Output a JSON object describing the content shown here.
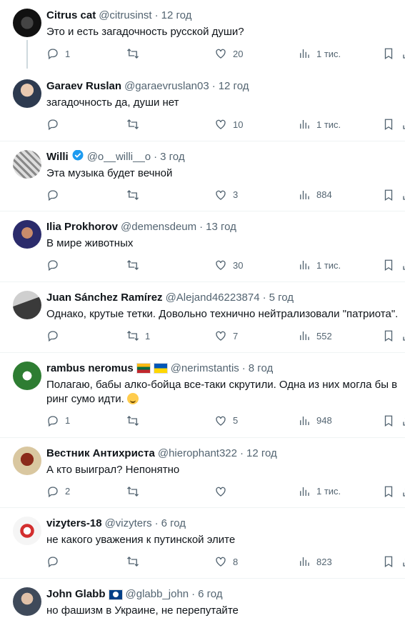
{
  "replies": [
    {
      "author": "Citrus cat",
      "handle": "@citrusinst",
      "time": "12 год",
      "text": "Это и есть загадочность русской души?",
      "replies": "1",
      "retweets": "",
      "likes": "20",
      "views": "1 тис."
    },
    {
      "author": "Garaev Ruslan",
      "handle": "@garaevruslan03",
      "time": "12 год",
      "text": "загадочность да, души нет",
      "replies": "",
      "retweets": "",
      "likes": "10",
      "views": "1 тис."
    },
    {
      "author": "Willi",
      "handle": "@o__willi__o",
      "time": "3 год",
      "text": "Эта музыка будет вечной",
      "replies": "",
      "retweets": "",
      "likes": "3",
      "views": "884"
    },
    {
      "author": "Ilia Prokhorov",
      "handle": "@demensdeum",
      "time": "13 год",
      "text": "В мире животных",
      "replies": "",
      "retweets": "",
      "likes": "30",
      "views": "1 тис."
    },
    {
      "author": "Juan Sánchez Ramírez",
      "handle": "@Alejand46223874",
      "time": "5 год",
      "text": "Однако, крутые тетки. Довольно технично нейтрализовали \"патриота\".",
      "replies": "",
      "retweets": "1",
      "likes": "7",
      "views": "552"
    },
    {
      "author": "rambus neromus",
      "handle": "@nerimstantis",
      "time": "8 год",
      "text": "Полагаю, бабы алко-бойца все-таки скрутили. Одна из них могла бы в ринг сумо идти.",
      "replies": "1",
      "retweets": "",
      "likes": "5",
      "views": "948"
    },
    {
      "author": "Вестник Антихриста",
      "handle": "@hierophant322",
      "time": "12 год",
      "text": "А кто выиграл? Непонятно",
      "replies": "2",
      "retweets": "",
      "likes": "",
      "views": "1 тис."
    },
    {
      "author": "vizyters-18",
      "handle": "@vizyters",
      "time": "6 год",
      "text": "не какого уважения к путинской элите",
      "replies": "",
      "retweets": "",
      "likes": "8",
      "views": "823"
    },
    {
      "author": "John Glabb",
      "handle": "@glabb_john",
      "time": "6 год",
      "text": "но фашизм в Украине, не перепутайте"
    }
  ],
  "separator": "·",
  "colors": {
    "text": "#0f1419",
    "muted": "#536471",
    "verified": "#1d9bf0",
    "divider": "#eff3f4"
  },
  "icons": [
    "reply-icon",
    "retweet-icon",
    "like-icon",
    "views-icon",
    "bookmark-icon",
    "share-icon",
    "verified-badge-icon"
  ]
}
